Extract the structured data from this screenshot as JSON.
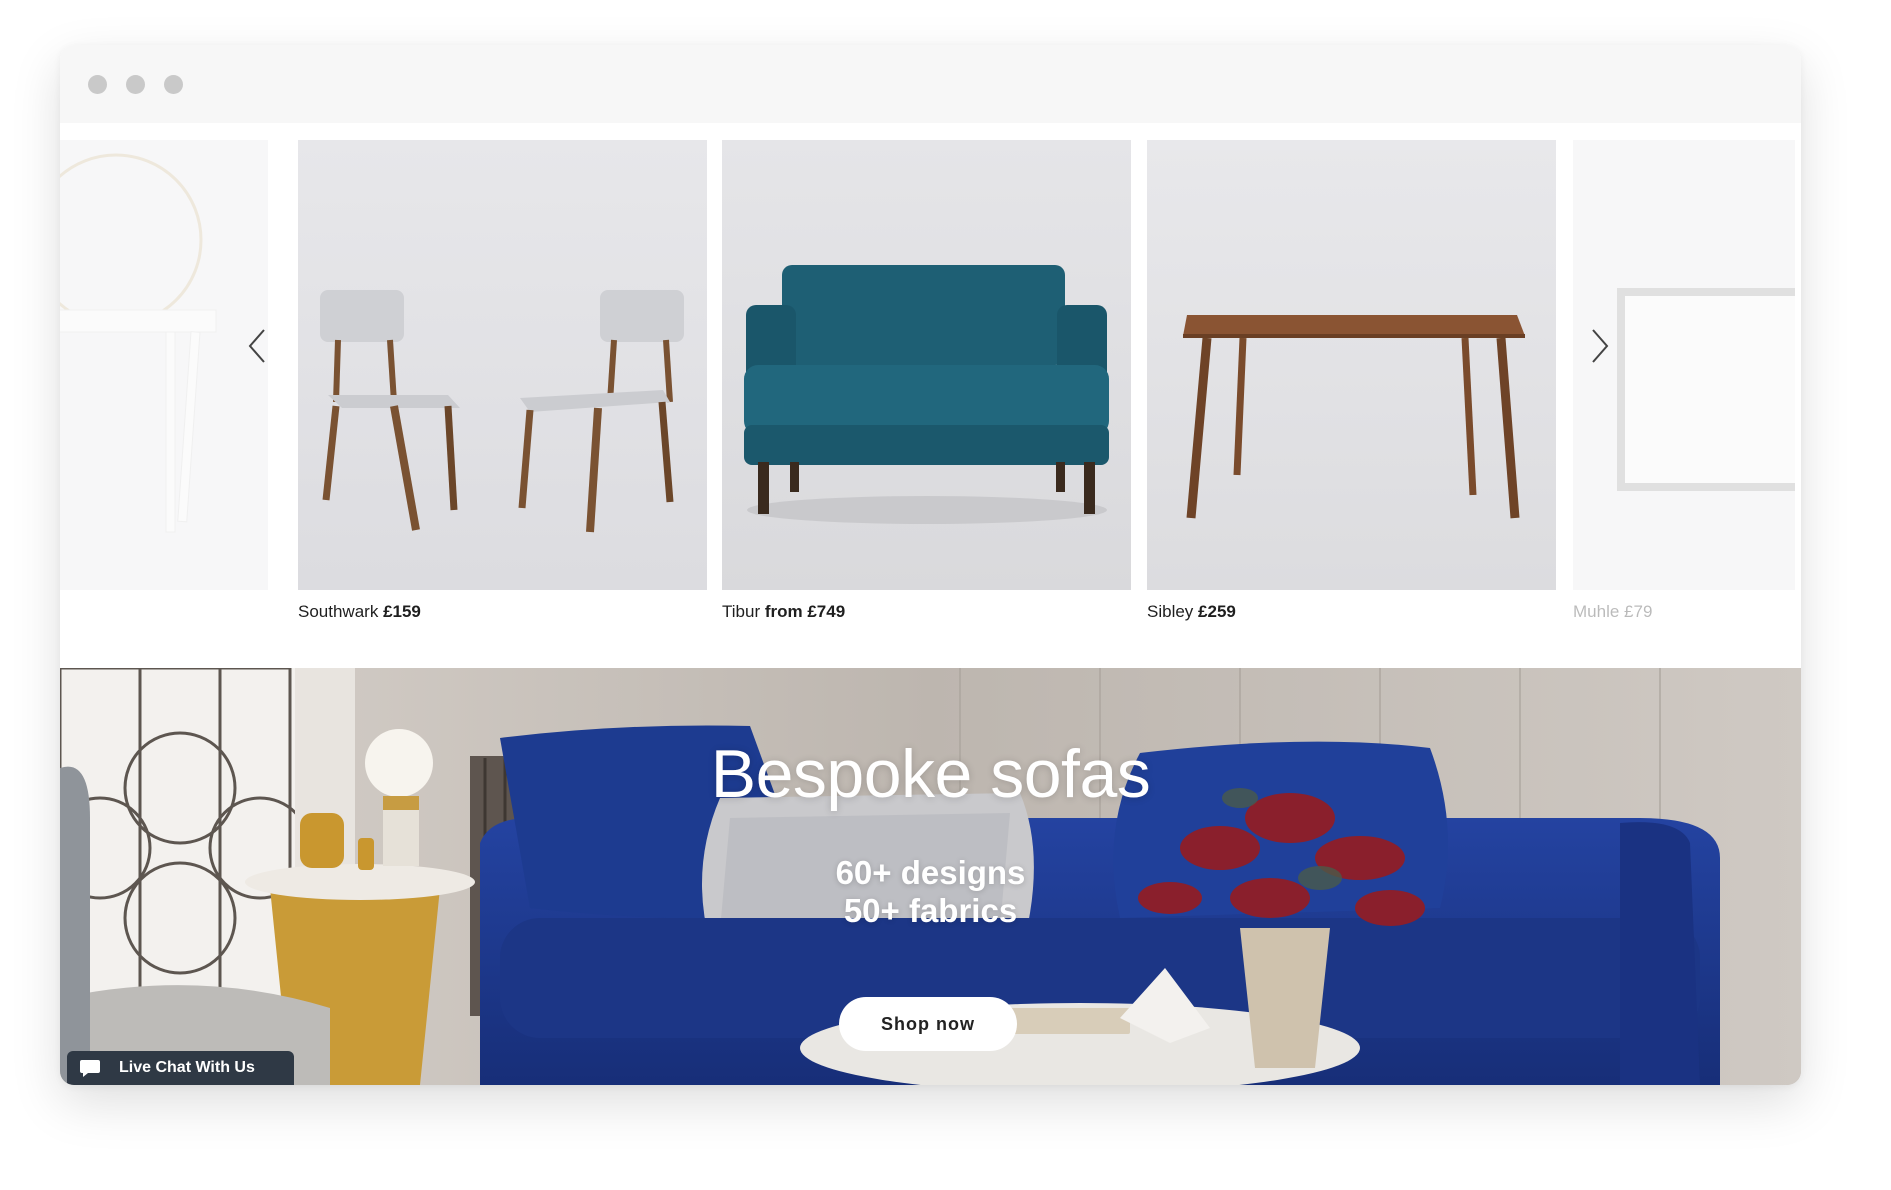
{
  "window": {
    "controls": [
      "close",
      "minimize",
      "maximize"
    ]
  },
  "carousel": {
    "prev_icon": "chevron-left-icon",
    "next_icon": "chevron-right-icon",
    "items": [
      {
        "name": "",
        "price_prefix": "",
        "price": "",
        "image": "white dressing table"
      },
      {
        "name": "Southwark",
        "price_prefix": "",
        "price": "£159",
        "image": "pair of grey dining chairs"
      },
      {
        "name": "Tibur",
        "price_prefix": "from ",
        "price": "£749",
        "image": "teal velvet loveseat"
      },
      {
        "name": "Sibley",
        "price_prefix": "",
        "price": "£259",
        "image": "wooden desk"
      },
      {
        "name": "Muhle",
        "price_prefix": "",
        "price": "£79",
        "image": "framed mirror"
      }
    ]
  },
  "hero": {
    "title": "Bespoke sofas",
    "line1": "60+ designs",
    "line2": "50+ fabrics",
    "cta": "Shop now"
  },
  "chat": {
    "label": "Live Chat With Us",
    "icon": "chat-bubble-icon"
  },
  "colors": {
    "sofa_blue": "#1f3a8c",
    "teal": "#1e5f74",
    "chat_bg": "#2f3945"
  }
}
